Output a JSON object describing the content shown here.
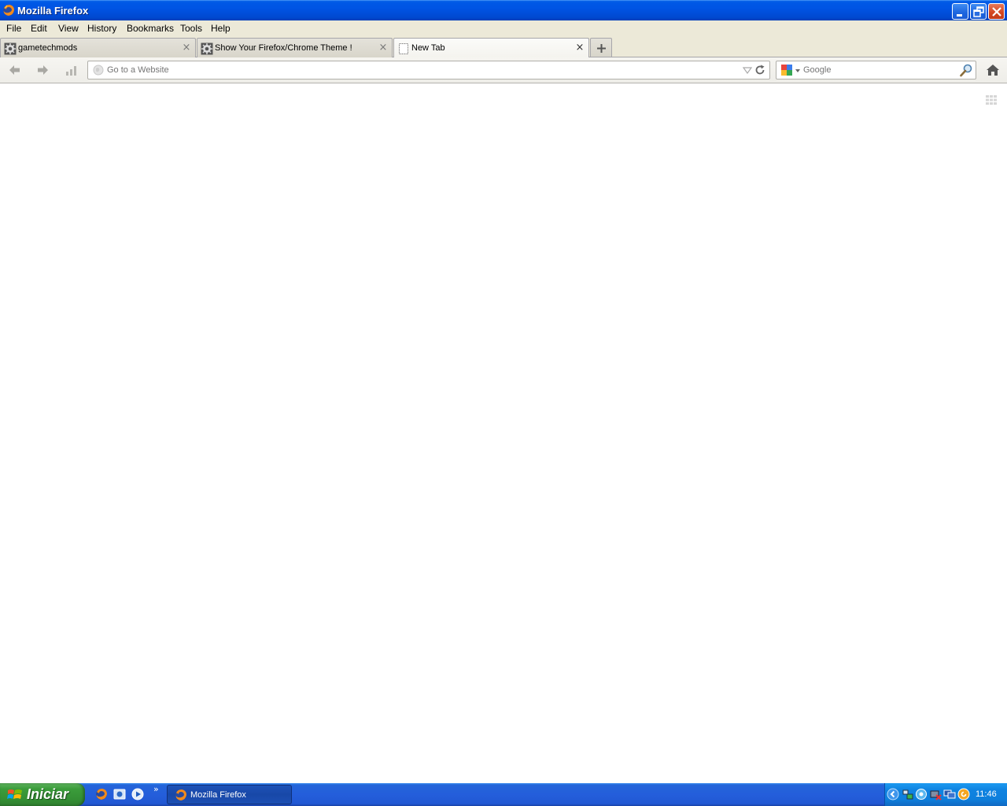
{
  "window": {
    "title": "Mozilla Firefox"
  },
  "menu": {
    "items": [
      "File",
      "Edit",
      "View",
      "History",
      "Bookmarks",
      "Tools",
      "Help"
    ]
  },
  "tabs": [
    {
      "label": "gametechmods",
      "favicon": "gear-icon",
      "active": false
    },
    {
      "label": "Show Your Firefox/Chrome Theme !",
      "favicon": "gear-icon",
      "active": false
    },
    {
      "label": "New Tab",
      "favicon": "blank-page-icon",
      "active": true
    }
  ],
  "navbar": {
    "url_placeholder": "Go to a Website",
    "search_placeholder": "Google",
    "search_engine": "google-icon"
  },
  "taskbar": {
    "start_label": "Iniciar",
    "task_label": "Mozilla Firefox",
    "clock": "11:46",
    "quicklaunch_chevron": "»"
  }
}
